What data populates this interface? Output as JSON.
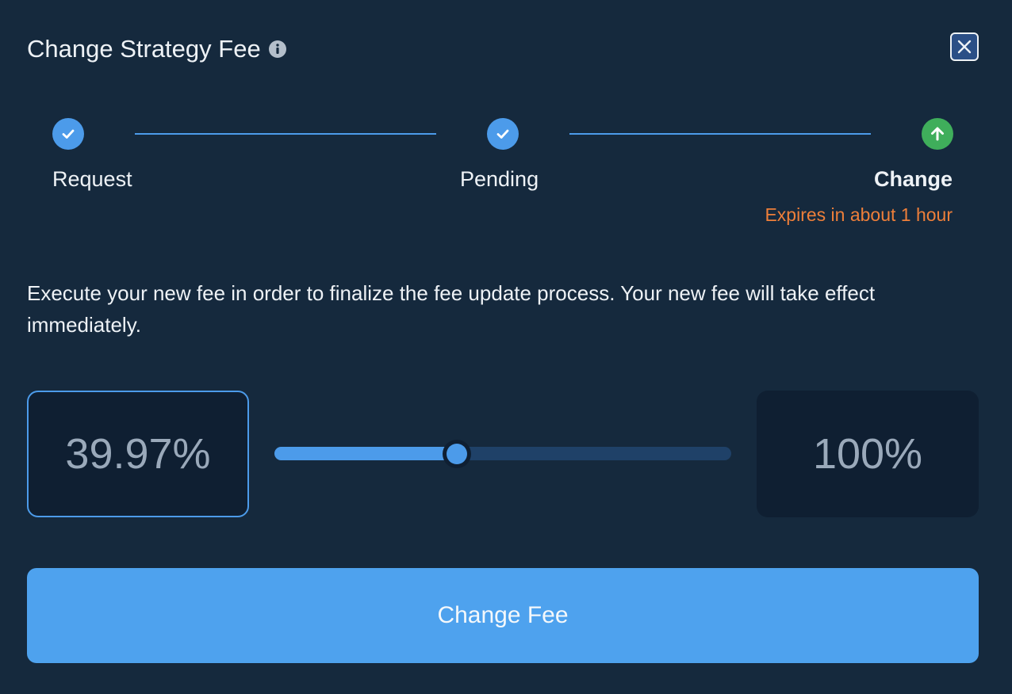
{
  "dialog": {
    "title": "Change Strategy Fee",
    "info_icon": "info-circle-icon",
    "close_icon": "close-icon"
  },
  "stepper": {
    "steps": [
      {
        "label": "Request",
        "status": "completed",
        "icon": "check-icon"
      },
      {
        "label": "Pending",
        "status": "completed",
        "icon": "check-icon"
      },
      {
        "label": "Change",
        "status": "active",
        "icon": "arrow-up-icon"
      }
    ],
    "expires_text": "Expires in about 1 hour"
  },
  "description": "Execute your new fee in order to finalize the fee update process. Your new fee will take effect immediately.",
  "fee": {
    "value": "39.97%",
    "max_label": "100%",
    "slider_fraction": 0.4
  },
  "action": {
    "label": "Change Fee"
  },
  "colors": {
    "background": "#15293d",
    "accent": "#4c9bea",
    "success": "#3fae5b",
    "warning": "#ee7f3a",
    "panel": "#0f1f32"
  }
}
